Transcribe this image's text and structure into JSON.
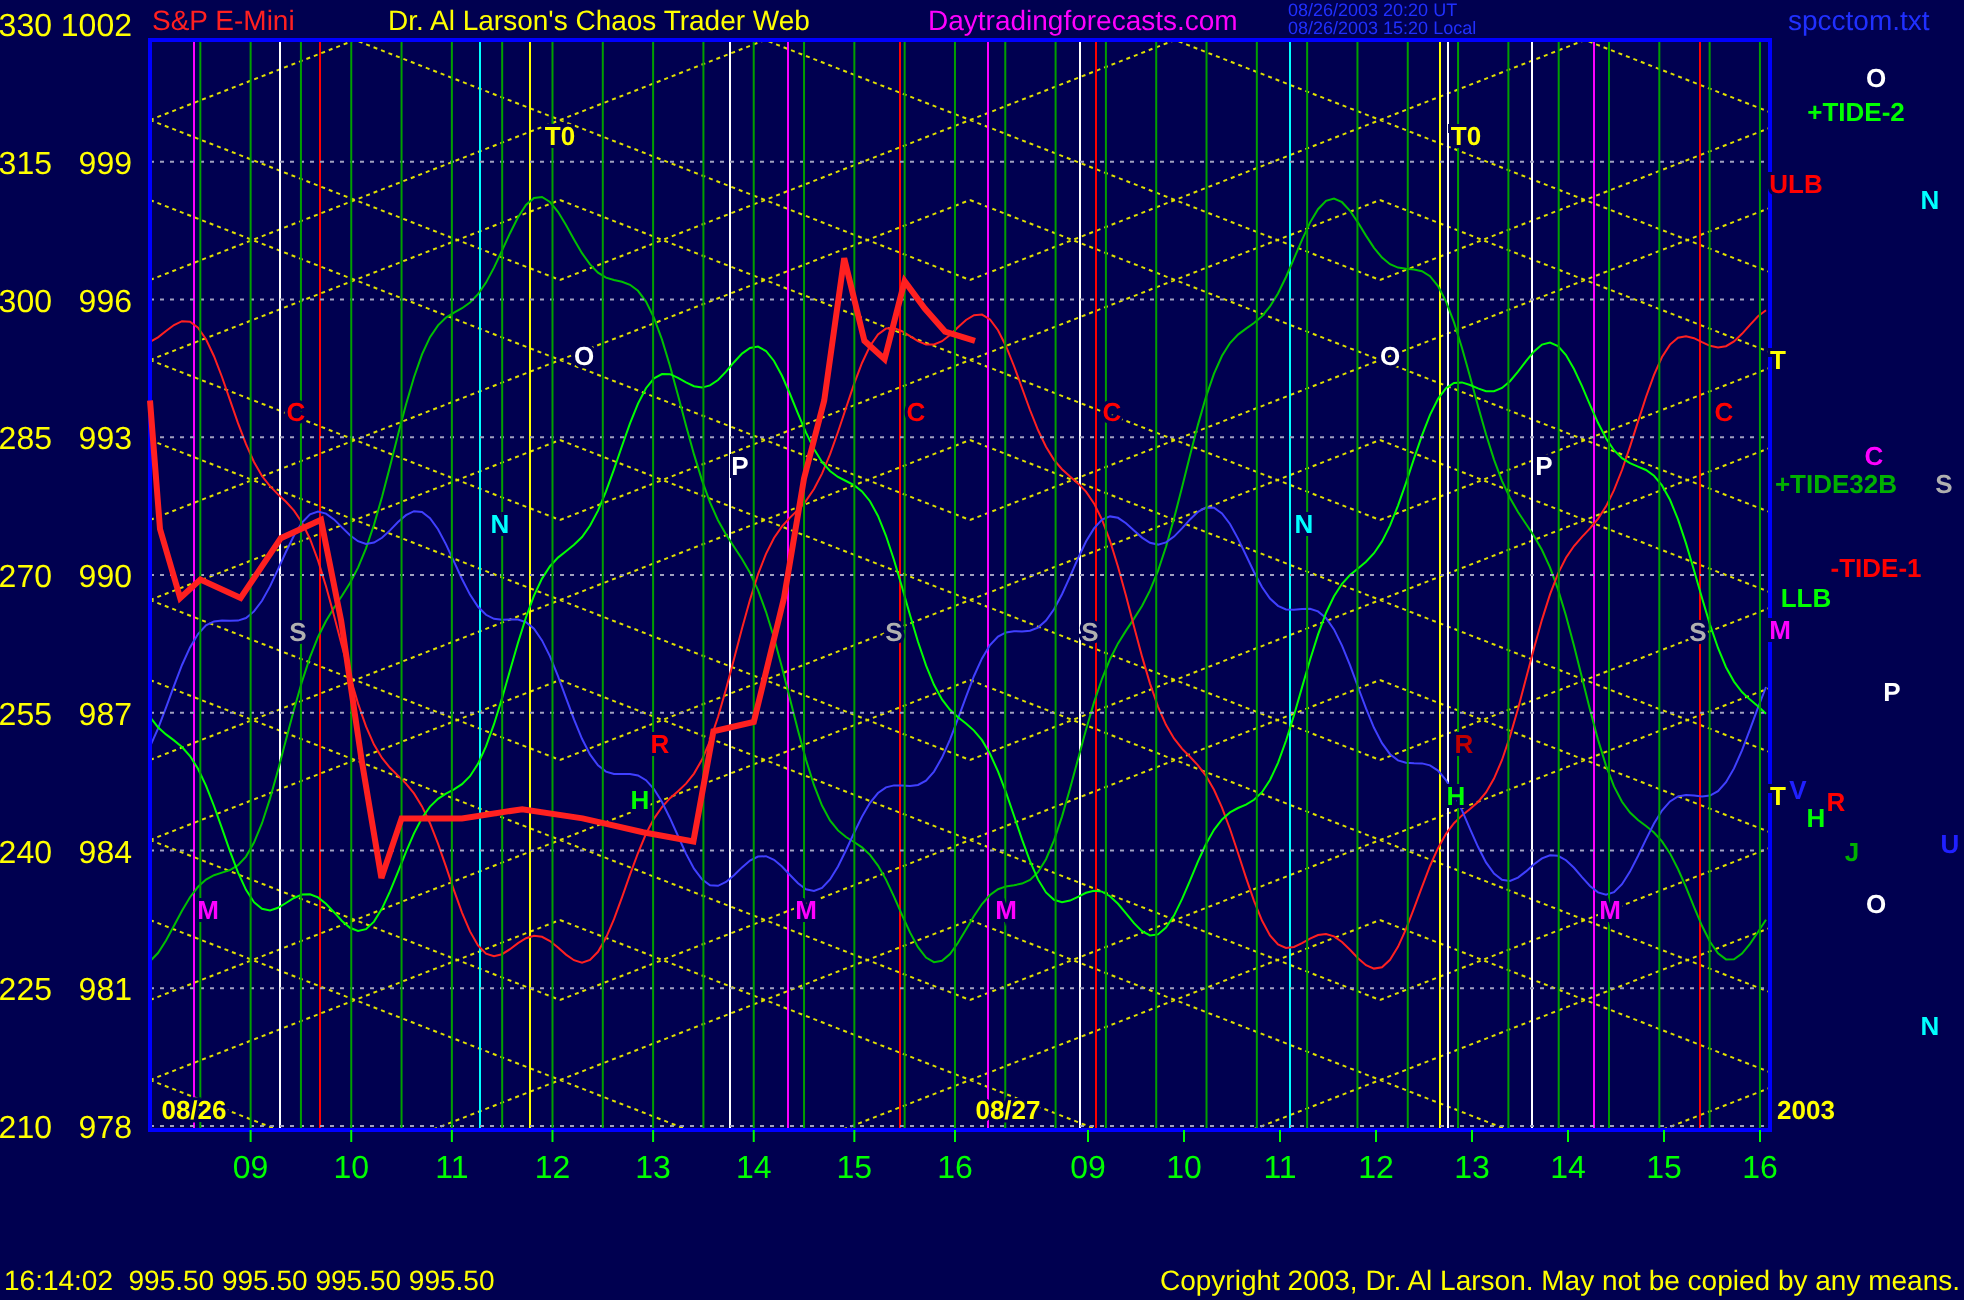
{
  "header": {
    "symbol": "S&P E-Mini",
    "title": "Dr. Al Larson's Chaos Trader Web",
    "site": "Daytradingforecasts.com",
    "timestamps": [
      "08/26/2003 20:20 UT",
      "08/26/2003 15:20 Local"
    ],
    "file": "spcctom.txt"
  },
  "left_scale": [
    "330",
    "315",
    "300",
    "285",
    "270",
    "255",
    "240",
    "225",
    "210"
  ],
  "chart": {
    "chart_data": {
      "type": "line",
      "grid": true,
      "xlim": [
        8,
        24.1
      ],
      "ylim": [
        978,
        1002
      ],
      "yticks": [
        {
          "value": 1002,
          "label": "1002"
        },
        {
          "value": 999,
          "label": "999"
        },
        {
          "value": 996,
          "label": "996"
        },
        {
          "value": 993,
          "label": "993"
        },
        {
          "value": 990,
          "label": "990"
        },
        {
          "value": 987,
          "label": "987"
        },
        {
          "value": 984,
          "label": "984"
        },
        {
          "value": 981,
          "label": "981"
        },
        {
          "value": 978,
          "label": "978"
        }
      ],
      "xticks": [
        {
          "value": 9,
          "label": "09"
        },
        {
          "value": 10,
          "label": "10"
        },
        {
          "value": 11,
          "label": "11"
        },
        {
          "value": 12,
          "label": "12"
        },
        {
          "value": 13,
          "label": "13"
        },
        {
          "value": 14,
          "label": "14"
        },
        {
          "value": 15,
          "label": "15"
        },
        {
          "value": 16,
          "label": "16"
        }
      ],
      "x": [
        8.0,
        8.1,
        8.3,
        8.5,
        8.9,
        9.3,
        9.7,
        9.9,
        10.1,
        10.3,
        10.5,
        11.1,
        11.7,
        12.3,
        12.9,
        13.4,
        13.6,
        14.0,
        14.3,
        14.5,
        14.7,
        14.9,
        15.1,
        15.3,
        15.5,
        15.7,
        15.9,
        16.2
      ],
      "series": [
        {
          "color": "#ff2020",
          "values": [
            993.8,
            991.0,
            989.5,
            989.9,
            989.5,
            990.8,
            991.2,
            989.0,
            986.0,
            983.4,
            984.7,
            984.7,
            984.9,
            984.7,
            984.4,
            984.2,
            986.6,
            986.8,
            989.5,
            992.1,
            993.8,
            996.9,
            995.1,
            994.7,
            996.4,
            995.8,
            995.3,
            995.1
          ]
        }
      ]
    },
    "second_day_hours": [
      "09",
      "10",
      "11",
      "12",
      "13",
      "14",
      "15",
      "16"
    ],
    "labels": [
      {
        "text": "T0",
        "color": "#ffff00"
      },
      {
        "text": "T0",
        "color": "#ffff00"
      },
      {
        "text": "O",
        "color": "#ffffff"
      },
      {
        "text": "O",
        "color": "#ffffff"
      },
      {
        "text": "C",
        "color": "#ff0000"
      },
      {
        "text": "C",
        "color": "#ff0000"
      },
      {
        "text": "C",
        "color": "#ff0000"
      },
      {
        "text": "C",
        "color": "#ff0000"
      },
      {
        "text": "P",
        "color": "#ffffff"
      },
      {
        "text": "P",
        "color": "#ffffff"
      },
      {
        "text": "N",
        "color": "#00ffff"
      },
      {
        "text": "N",
        "color": "#00ffff"
      },
      {
        "text": "S",
        "color": "#b0b0b0"
      },
      {
        "text": "S",
        "color": "#b0b0b0"
      },
      {
        "text": "S",
        "color": "#b0b0b0"
      },
      {
        "text": "S",
        "color": "#b0b0b0"
      },
      {
        "text": "R",
        "color": "#ff0000"
      },
      {
        "text": "R",
        "color": "#c00000"
      },
      {
        "text": "H",
        "color": "#00ff00"
      },
      {
        "text": "H",
        "color": "#00ff00"
      },
      {
        "text": "M",
        "color": "#ff00ff"
      },
      {
        "text": "M",
        "color": "#ff00ff"
      },
      {
        "text": "M",
        "color": "#ff00ff"
      },
      {
        "text": "M",
        "color": "#ff00ff"
      },
      {
        "text": "08/26",
        "color": "#ffff00"
      },
      {
        "text": "08/27",
        "color": "#ffff00"
      },
      {
        "text": "2003",
        "color": "#ffff00"
      },
      {
        "text": "O",
        "color": "#ffffff"
      },
      {
        "text": "+TIDE-2",
        "color": "#00ff00"
      },
      {
        "text": "ULB",
        "color": "#ff0000"
      },
      {
        "text": "N",
        "color": "#00ffff"
      },
      {
        "text": "T",
        "color": "#ffff00"
      },
      {
        "text": "C",
        "color": "#ff00ff"
      },
      {
        "text": "+TIDE32B",
        "color": "#00b000"
      },
      {
        "text": "S",
        "color": "#b0b0b0"
      },
      {
        "text": "-TIDE-1",
        "color": "#ff0000"
      },
      {
        "text": "LLB",
        "color": "#00ff00"
      },
      {
        "text": "M",
        "color": "#ff00ff"
      },
      {
        "text": "P",
        "color": "#ffffff"
      },
      {
        "text": "T",
        "color": "#ffff00"
      },
      {
        "text": "V",
        "color": "#2020ff"
      },
      {
        "text": "R",
        "color": "#ff0000"
      },
      {
        "text": "H",
        "color": "#00ff00"
      },
      {
        "text": "J",
        "color": "#00b000"
      },
      {
        "text": "U",
        "color": "#2020ff"
      },
      {
        "text": "O",
        "color": "#ffffff"
      },
      {
        "text": "N",
        "color": "#00ffff"
      }
    ]
  },
  "footer": {
    "quote": "16:14:02  995.50 995.50 995.50 995.50",
    "copyright": "Copyright 2003, Dr. Al Larson. May not be copied by any means."
  }
}
